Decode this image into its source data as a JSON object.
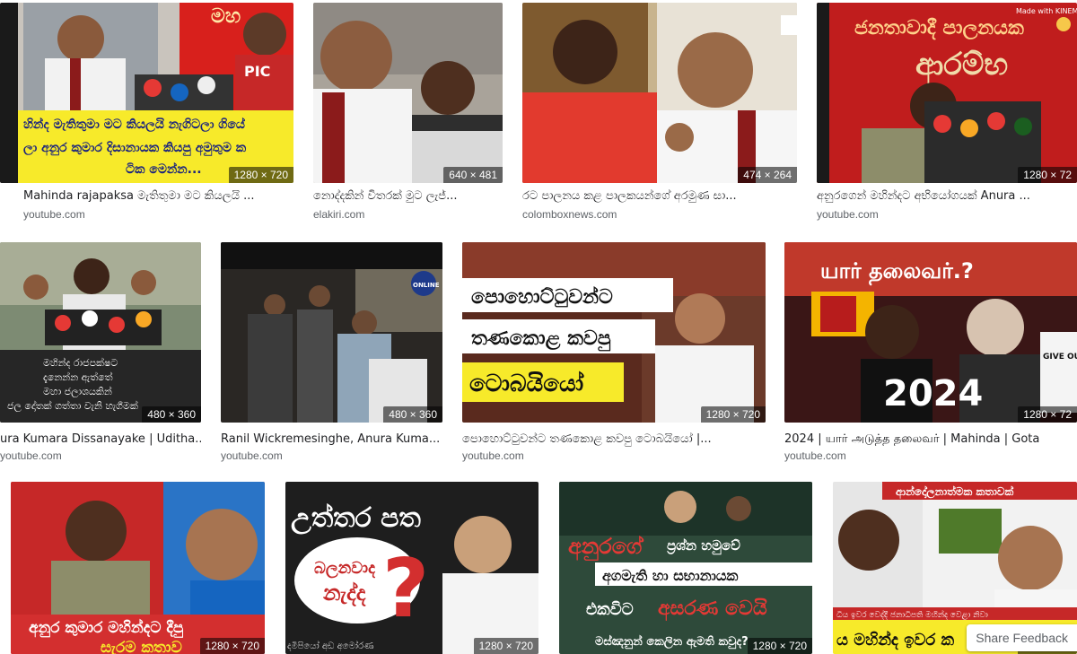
{
  "results": [
    {
      "title": "Mahinda rajapaksa මැතිතුමා මට කියලයි ...",
      "source": "youtube.com",
      "dimensions": "1280 × 720"
    },
    {
      "title": "නොද්දකින් විතරක් මුට ලැජ්...",
      "source": "elakiri.com",
      "dimensions": "640 × 481"
    },
    {
      "title": "රට පාලනය කළ පාලකයන්ගේ අරමුණ සා...",
      "source": "colomboxnews.com",
      "dimensions": "474 × 264"
    },
    {
      "title": "අනුරගෙන් මහින්දට අභියෝගයක් Anura ...",
      "source": "youtube.com",
      "dimensions": "1280 × 72"
    },
    {
      "title": "ura Kumara Dissanayake | Uditha...",
      "source": "youtube.com",
      "dimensions": "480 × 360"
    },
    {
      "title": "Ranil Wickremesinghe, Anura Kuma...",
      "source": "youtube.com",
      "dimensions": "480 × 360"
    },
    {
      "title": "පොහොට්ටුවන්ට තණකොළ කවපු ටොබයියෝ |...",
      "source": "youtube.com",
      "dimensions": "1280 × 720"
    },
    {
      "title": "2024 | யார் அடுத்த தலைவர் | Mahinda | Gota",
      "source": "youtube.com",
      "dimensions": "1280 × 72"
    },
    {
      "title": "",
      "source": "",
      "dimensions": "1280 × 720"
    },
    {
      "title": "",
      "source": "",
      "dimensions": "1280 × 720"
    },
    {
      "title": "",
      "source": "",
      "dimensions": "1280 × 720"
    },
    {
      "title": "",
      "source": "",
      "dimensions": "1280 × 72"
    }
  ],
  "thumb_text": {
    "t1_caption_a": "හින්ද මැතිතුමා මට කියලයි නැගිටලා ගියේ",
    "t1_caption_b": "ලා අනුර කුමාර දිසානායක කියපු අමුතුම ක",
    "t1_caption_c": "ටික මෙන්න...",
    "t1_sign": "මහ",
    "t1_sign2": "PIC",
    "t4_banner": "ජනතාවාදී පාලනයක",
    "t4_banner2": "ආරම්භ",
    "t4_watermark": "Made with KINEMA",
    "t5_caption_a": "මහින්ද රාජපක්ෂට",
    "t5_caption_b": "දැනෙන්න ඇත්තේ",
    "t5_caption_c": "මහා ජලාශයකින්",
    "t5_caption_d": "ජල දෝතක් ගත්තා වැනි හැගීමක්",
    "t6_logo": "ONLINE",
    "t7_line1": "පොහොට්ටුවන්ට",
    "t7_line2": "තණකොළ කවපු",
    "t7_line3": "ටොබයියෝ",
    "t8_top": "யார் தலைவர்.?",
    "t8_year": "2024",
    "t8_sign": "GIVE OUR STOLE",
    "t9_caption_a": "අනුර කුමාර මහින්දට දීපු",
    "t9_caption_b": "සැරම කතාව",
    "t10_top": "උත්තර පත",
    "t10_bubble_a": "බලනවාද",
    "t10_bubble_b": "නැද්ද",
    "t10_qmark": "?",
    "t10_bottom": "දමිපියෝ අඩ අමෝරණ",
    "t11_line1": "අනුරගේ",
    "t11_line1b": "ප්‍රශ්න හමුවේ",
    "t11_line2": "අගමැති හා සභානායක",
    "t11_line3a": "එකවිට",
    "t11_line3b": "අසරණ වෙයි",
    "t11_line4": "මස්ඤනුන් කෙලින ඇමති කවුද?",
    "t12_top": "ආන්දෝලනාත්මක කතාවක්",
    "t12_strip": "ධිය ඉවර වෙද්දී ජනාධිපති මහින්ද වෙළා නිවා",
    "t12_bottom": "ය මහින්ද ඉවර ක"
  },
  "feedback_label": "Share Feedback",
  "colors": {
    "accent_red": "#d7261e",
    "caption_yellow": "#f7ea2a",
    "text_primary": "#202124",
    "text_secondary": "#5f6368"
  }
}
